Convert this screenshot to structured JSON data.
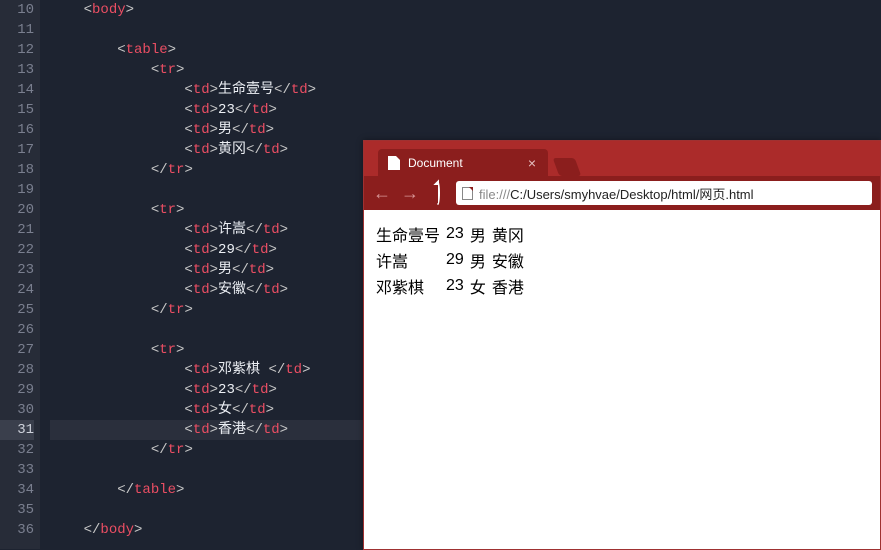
{
  "editor": {
    "firstLine": 10,
    "currentLine": 31,
    "lines": [
      [
        "    ",
        "<",
        "body",
        ">"
      ],
      [
        ""
      ],
      [
        "        ",
        "<",
        "table",
        ">"
      ],
      [
        "            ",
        "<",
        "tr",
        ">"
      ],
      [
        "                ",
        "<",
        "td",
        ">",
        "生命壹号",
        "</",
        "td",
        ">"
      ],
      [
        "                ",
        "<",
        "td",
        ">",
        "23",
        "</",
        "td",
        ">"
      ],
      [
        "                ",
        "<",
        "td",
        ">",
        "男",
        "</",
        "td",
        ">"
      ],
      [
        "                ",
        "<",
        "td",
        ">",
        "黄冈",
        "</",
        "td",
        ">"
      ],
      [
        "            ",
        "</",
        "tr",
        ">"
      ],
      [
        ""
      ],
      [
        "            ",
        "<",
        "tr",
        ">"
      ],
      [
        "                ",
        "<",
        "td",
        ">",
        "许嵩",
        "</",
        "td",
        ">"
      ],
      [
        "                ",
        "<",
        "td",
        ">",
        "29",
        "</",
        "td",
        ">"
      ],
      [
        "                ",
        "<",
        "td",
        ">",
        "男",
        "</",
        "td",
        ">"
      ],
      [
        "                ",
        "<",
        "td",
        ">",
        "安徽",
        "</",
        "td",
        ">"
      ],
      [
        "            ",
        "</",
        "tr",
        ">"
      ],
      [
        ""
      ],
      [
        "            ",
        "<",
        "tr",
        ">"
      ],
      [
        "                ",
        "<",
        "td",
        ">",
        "邓紫棋 ",
        "</",
        "td",
        ">"
      ],
      [
        "                ",
        "<",
        "td",
        ">",
        "23",
        "</",
        "td",
        ">"
      ],
      [
        "                ",
        "<",
        "td",
        ">",
        "女",
        "</",
        "td",
        ">"
      ],
      [
        "                ",
        "<",
        "td",
        ">",
        "香港",
        "</",
        "td",
        ">"
      ],
      [
        "            ",
        "</",
        "tr",
        ">"
      ],
      [
        ""
      ],
      [
        "        ",
        "</",
        "table",
        ">"
      ],
      [
        ""
      ],
      [
        "    ",
        "</",
        "body",
        ">"
      ]
    ]
  },
  "browser": {
    "tabTitle": "Document",
    "url": {
      "scheme": "file:///",
      "path": "C:/Users/smyhvae/Desktop/html/网页.html"
    },
    "table": [
      {
        "name": "生命壹号",
        "age": "23",
        "gender": "男",
        "city": "黄冈"
      },
      {
        "name": "许嵩",
        "age": "29",
        "gender": "男",
        "city": "安徽"
      },
      {
        "name": "邓紫棋",
        "age": "23",
        "gender": "女",
        "city": "香港"
      }
    ]
  }
}
